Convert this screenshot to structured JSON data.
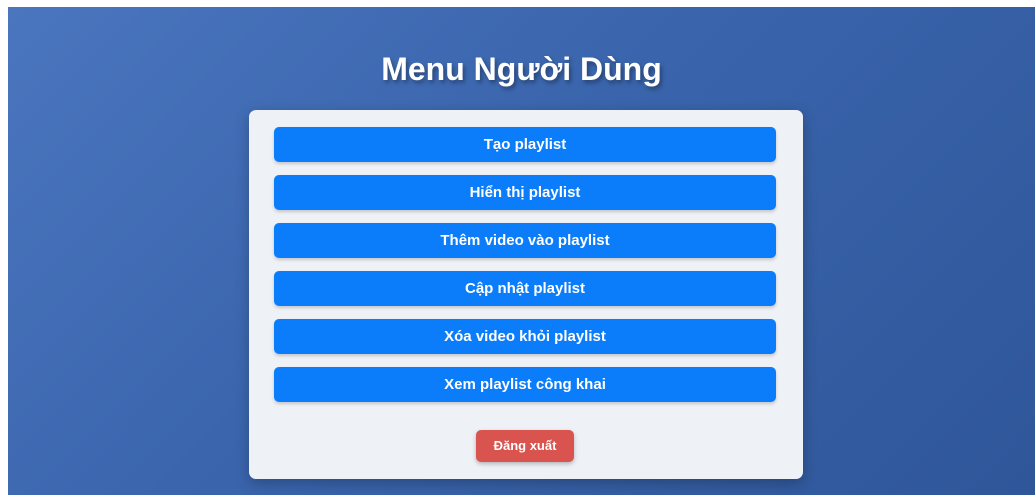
{
  "header": {
    "title": "Menu Người Dùng"
  },
  "menu": {
    "items": [
      {
        "label": "Tạo playlist"
      },
      {
        "label": "Hiển thị playlist"
      },
      {
        "label": "Thêm video vào playlist"
      },
      {
        "label": "Cập nhật playlist"
      },
      {
        "label": "Xóa video khỏi playlist"
      },
      {
        "label": "Xem playlist công khai"
      }
    ]
  },
  "logout": {
    "label": "Đăng xuất"
  },
  "colors": {
    "background_gradient_start": "#4a76bf",
    "background_gradient_end": "#2f5699",
    "card_background": "#eef1f6",
    "menu_button": "#0b7dfb",
    "logout_button": "#d9534f",
    "button_text": "#ffffff"
  }
}
